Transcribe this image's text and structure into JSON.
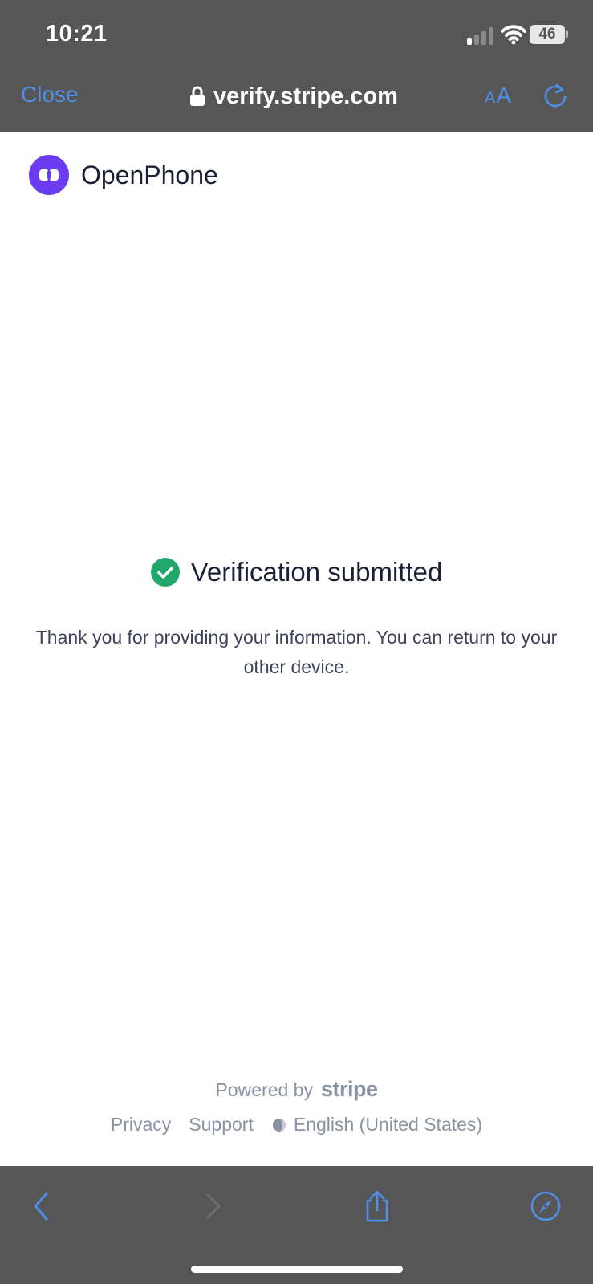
{
  "status_bar": {
    "time": "10:21",
    "battery": "46"
  },
  "browser": {
    "close_label": "Close",
    "url": "verify.stripe.com",
    "text_size_label_small": "A",
    "text_size_label_large": "A"
  },
  "brand": {
    "name": "OpenPhone",
    "logo_color": "#6b3cf0"
  },
  "message": {
    "title": "Verification submitted",
    "body": "Thank you for providing your information. You can return to your other device.",
    "check_color": "#20a86b"
  },
  "footer": {
    "powered_by": "Powered by",
    "stripe": "stripe",
    "links": {
      "privacy": "Privacy",
      "support": "Support",
      "language": "English (United States)"
    }
  },
  "colors": {
    "chrome_bg": "#565656",
    "accent": "#4f8fe8"
  },
  "toolbar_icons": [
    "back-icon",
    "forward-icon",
    "share-icon",
    "compass-icon"
  ]
}
